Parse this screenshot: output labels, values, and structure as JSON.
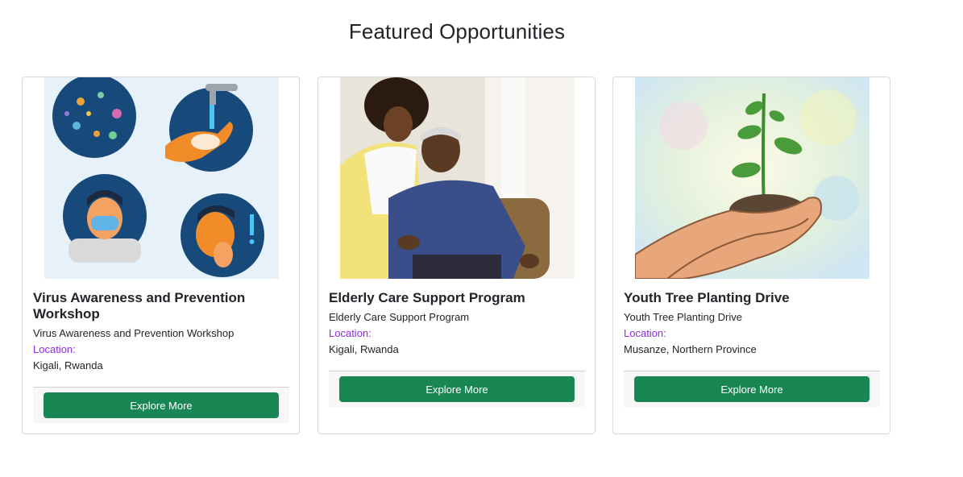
{
  "page": {
    "title": "Featured Opportunities"
  },
  "cards": [
    {
      "title": "Virus Awareness and Prevention Workshop",
      "subtitle": "Virus Awareness and Prevention Workshop",
      "location_label": "Location:",
      "location": "Kigali, Rwanda",
      "button_label": "Explore More",
      "image": "virus-prevention-illustration"
    },
    {
      "title": "Elderly Care Support Program",
      "subtitle": "Elderly Care Support Program",
      "location_label": "Location:",
      "location": "Kigali, Rwanda",
      "button_label": "Explore More",
      "image": "elderly-care-photo"
    },
    {
      "title": "Youth Tree Planting Drive",
      "subtitle": "Youth Tree Planting Drive",
      "location_label": "Location:",
      "location": "Musanze, Northern Province",
      "button_label": "Explore More",
      "image": "seedling-in-hands-illustration"
    }
  ],
  "colors": {
    "button": "#198754",
    "location_label": "#8a2be2",
    "card_border": "#d9d9d9"
  }
}
